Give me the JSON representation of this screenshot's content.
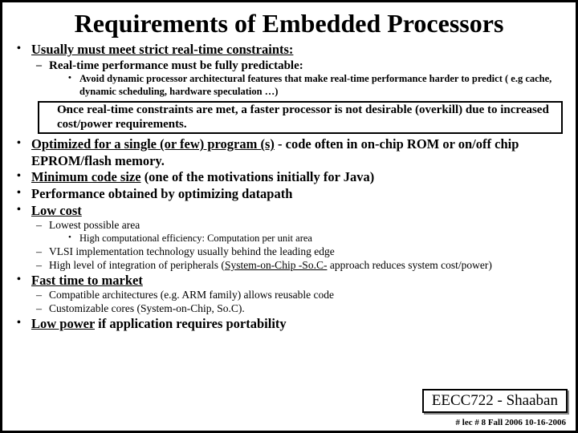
{
  "title": "Requirements of Embedded Processors",
  "p1": "Usually must meet strict real-time constraints:",
  "p1a": "Real-time performance must be fully predictable:",
  "p1a1": "Avoid dynamic processor architectural features that make real-time performance harder to predict ( e.g cache, dynamic scheduling, hardware speculation …)",
  "p1b": "Once real-time constraints are met, a faster processor is not desirable (overkill) due to increased cost/power requirements.",
  "p2a": "Optimized for a single (or few) program (s)",
  "p2b": " - code often in on-chip ROM or on/off chip EPROM/flash memory.",
  "p3a": "Minimum code size",
  "p3b": " (one of the motivations initially for Java)",
  "p4": "Performance obtained by optimizing datapath",
  "p5": "Low cost",
  "p5a": "Lowest possible area",
  "p5a1": "High computational efficiency:  Computation per unit area",
  "p5b": "VLSI implementation technology usually behind the leading edge",
  "p5c_a": "High level of integration of peripherals (",
  "p5c_b": "System-on-Chip -So.C-",
  "p5c_c": " approach reduces system cost/power)",
  "p6": "Fast time to market",
  "p6a": "Compatible architectures  (e.g. ARM family) allows reusable code",
  "p6b": "Customizable cores (System-on-Chip, So.C).",
  "p7a": "Low power",
  "p7b": " if application requires portability",
  "badge": "EECC722 - Shaaban",
  "footer": "#  lec # 8    Fall 2006   10-16-2006"
}
